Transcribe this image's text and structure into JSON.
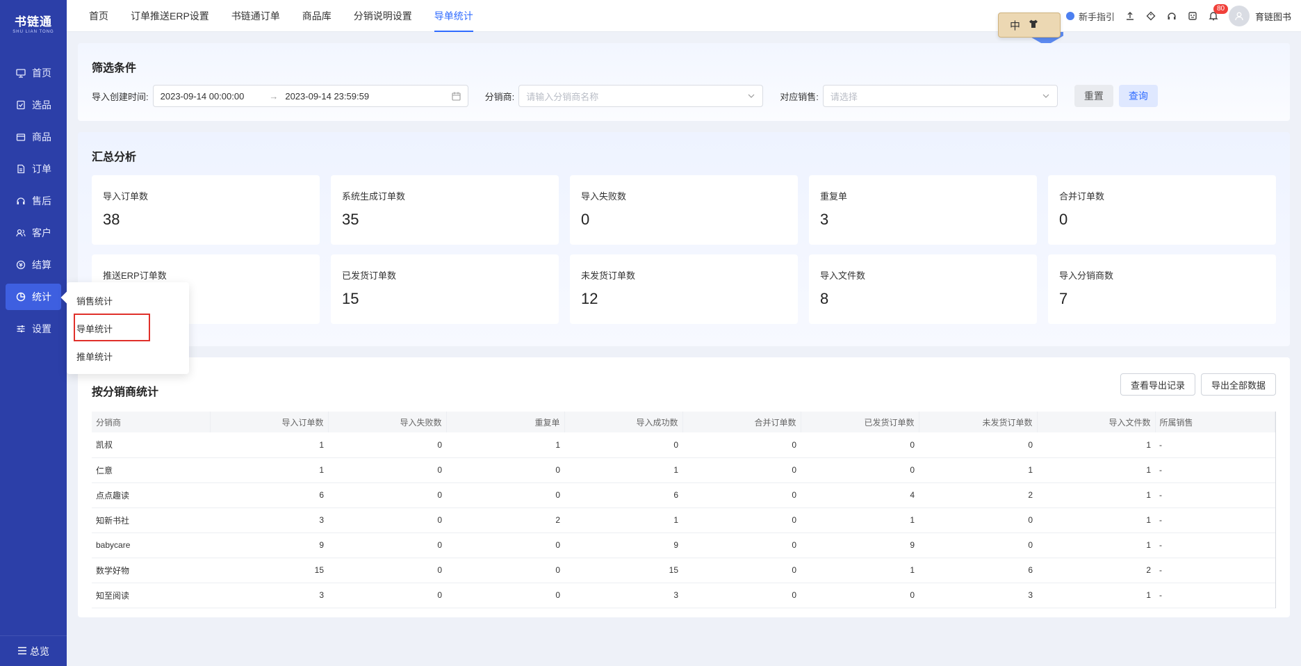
{
  "logo": {
    "main": "书链通",
    "sub": "SHU LIAN TONG"
  },
  "sidebar": {
    "items": [
      {
        "label": "首页",
        "icon": "monitor-icon"
      },
      {
        "label": "选品",
        "icon": "checklist-icon"
      },
      {
        "label": "商品",
        "icon": "box-icon"
      },
      {
        "label": "订单",
        "icon": "order-icon"
      },
      {
        "label": "售后",
        "icon": "service-icon"
      },
      {
        "label": "客户",
        "icon": "users-icon"
      },
      {
        "label": "结算",
        "icon": "settle-icon"
      },
      {
        "label": "统计",
        "icon": "chart-pie-icon",
        "active": true
      },
      {
        "label": "设置",
        "icon": "sliders-icon"
      }
    ],
    "footer": "总览"
  },
  "submenu": [
    "销售统计",
    "导单统计",
    "推单统计"
  ],
  "topbar": {
    "tabs": [
      "首页",
      "订单推送ERP设置",
      "书链通订单",
      "商品库",
      "分销说明设置",
      "导单统计"
    ],
    "active_tab": 5,
    "guide": "新手指引",
    "badge": "80",
    "user": "育链图书",
    "lang": "中"
  },
  "filter": {
    "title": "筛选条件",
    "date_label": "导入创建时间:",
    "date_start": "2023-09-14 00:00:00",
    "date_end": "2023-09-14 23:59:59",
    "dist_label": "分销商:",
    "dist_placeholder": "请输入分销商名称",
    "sales_label": "对应销售:",
    "sales_placeholder": "请选择",
    "reset": "重置",
    "query": "查询"
  },
  "summary": {
    "title": "汇总分析",
    "stats": [
      {
        "label": "导入订单数",
        "value": "38"
      },
      {
        "label": "系统生成订单数",
        "value": "35"
      },
      {
        "label": "导入失败数",
        "value": "0"
      },
      {
        "label": "重复单",
        "value": "3"
      },
      {
        "label": "合并订单数",
        "value": "0"
      },
      {
        "label": "推送ERP订单数",
        "value": ""
      },
      {
        "label": "已发货订单数",
        "value": "15"
      },
      {
        "label": "未发货订单数",
        "value": "12"
      },
      {
        "label": "导入文件数",
        "value": "8"
      },
      {
        "label": "导入分销商数",
        "value": "7"
      }
    ]
  },
  "dist": {
    "title": "按分销商统计",
    "btn_export_log": "查看导出记录",
    "btn_export_all": "导出全部数据",
    "columns": [
      "分销商",
      "导入订单数",
      "导入失败数",
      "重复单",
      "导入成功数",
      "合并订单数",
      "已发货订单数",
      "未发货订单数",
      "导入文件数",
      "所属销售"
    ],
    "rows": [
      [
        "凯叔",
        "1",
        "0",
        "1",
        "0",
        "0",
        "0",
        "0",
        "1",
        "-"
      ],
      [
        "仁意",
        "1",
        "0",
        "0",
        "1",
        "0",
        "0",
        "1",
        "1",
        "-"
      ],
      [
        "点点趣读",
        "6",
        "0",
        "0",
        "6",
        "0",
        "4",
        "2",
        "1",
        "-"
      ],
      [
        "知新书社",
        "3",
        "0",
        "2",
        "1",
        "0",
        "1",
        "0",
        "1",
        "-"
      ],
      [
        "babycare",
        "9",
        "0",
        "0",
        "9",
        "0",
        "9",
        "0",
        "1",
        "-"
      ],
      [
        "数学好物",
        "15",
        "0",
        "0",
        "15",
        "0",
        "1",
        "6",
        "2",
        "-"
      ],
      [
        "知至阅读",
        "3",
        "0",
        "0",
        "3",
        "0",
        "0",
        "3",
        "1",
        "-"
      ]
    ]
  }
}
